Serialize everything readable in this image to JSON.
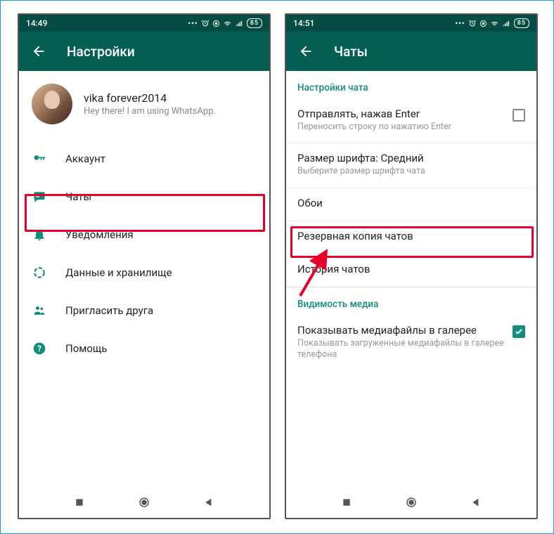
{
  "left": {
    "statusbar": {
      "time": "14:49",
      "battery": "85"
    },
    "appbar": {
      "title": "Настройки"
    },
    "profile": {
      "name": "vika forever2014",
      "status": "Hey there! I am using WhatsApp."
    },
    "menu": {
      "account": "Аккаунт",
      "chats": "Чаты",
      "notifications": "Уведомления",
      "data": "Данные и хранилище",
      "invite": "Пригласить друга",
      "help": "Помощь"
    }
  },
  "right": {
    "statusbar": {
      "time": "14:51",
      "battery": "85"
    },
    "appbar": {
      "title": "Чаты"
    },
    "section_chat_settings": "Настройки чата",
    "enter_send": {
      "primary": "Отправлять, нажав Enter",
      "secondary": "Переносить строку по нажатию Enter"
    },
    "font_size": {
      "primary": "Размер шрифта: Средний",
      "secondary": "Выберите размер шрифта чата"
    },
    "wallpaper": "Обои",
    "backup": "Резервная копия чатов",
    "history": "История чатов",
    "section_media": "Видимость медиа",
    "media_visibility": {
      "primary": "Показывать медиафайлы в галерее",
      "secondary": "Показывать загруженные медиафайлы в галерее телефона"
    }
  }
}
